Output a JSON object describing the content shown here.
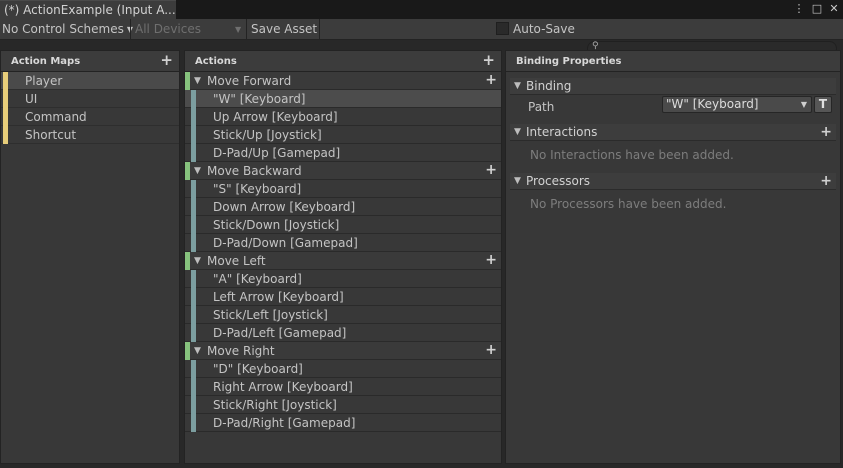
{
  "window": {
    "tab_title": "(*) ActionExample (Input A...",
    "menu_icon": "⋮",
    "maximize_icon": "□",
    "close_icon": "✕"
  },
  "toolbar": {
    "control_scheme": "No Control Schemes",
    "devices": "All Devices",
    "save_label": "Save Asset",
    "autosave_label": "Auto-Save",
    "search_icon": "⚲",
    "dropdown_arrow": "▼"
  },
  "action_maps": {
    "header": "Action Maps",
    "add_icon": "+",
    "items": [
      {
        "label": "Player"
      },
      {
        "label": "UI"
      },
      {
        "label": "Command"
      },
      {
        "label": "Shortcut"
      }
    ]
  },
  "actions": {
    "header": "Actions",
    "add_icon": "+",
    "expand_icon": "▼",
    "groups": [
      {
        "label": "Move Forward",
        "bindings": [
          "\"W\" [Keyboard]",
          "Up Arrow [Keyboard]",
          "Stick/Up [Joystick]",
          "D-Pad/Up [Gamepad]"
        ]
      },
      {
        "label": "Move Backward",
        "bindings": [
          "\"S\" [Keyboard]",
          "Down Arrow [Keyboard]",
          "Stick/Down [Joystick]",
          "D-Pad/Down [Gamepad]"
        ]
      },
      {
        "label": "Move Left",
        "bindings": [
          "\"A\" [Keyboard]",
          "Left Arrow [Keyboard]",
          "Stick/Left [Joystick]",
          "D-Pad/Left [Gamepad]"
        ]
      },
      {
        "label": "Move Right",
        "bindings": [
          "\"D\" [Keyboard]",
          "Right Arrow [Keyboard]",
          "Stick/Right [Joystick]",
          "D-Pad/Right [Gamepad]"
        ]
      }
    ]
  },
  "properties": {
    "header": "Binding Properties",
    "binding_label": "Binding",
    "path_label": "Path",
    "path_value": "\"W\" [Keyboard]",
    "t_button": "T",
    "interactions_label": "Interactions",
    "interactions_empty": "No Interactions have been added.",
    "processors_label": "Processors",
    "processors_empty": "No Processors have been added.",
    "add_icon": "+"
  },
  "colors": {
    "map_marker": "#e7cd7a",
    "action_marker": "#86c27d",
    "binding_marker": "#7c9ea0"
  }
}
